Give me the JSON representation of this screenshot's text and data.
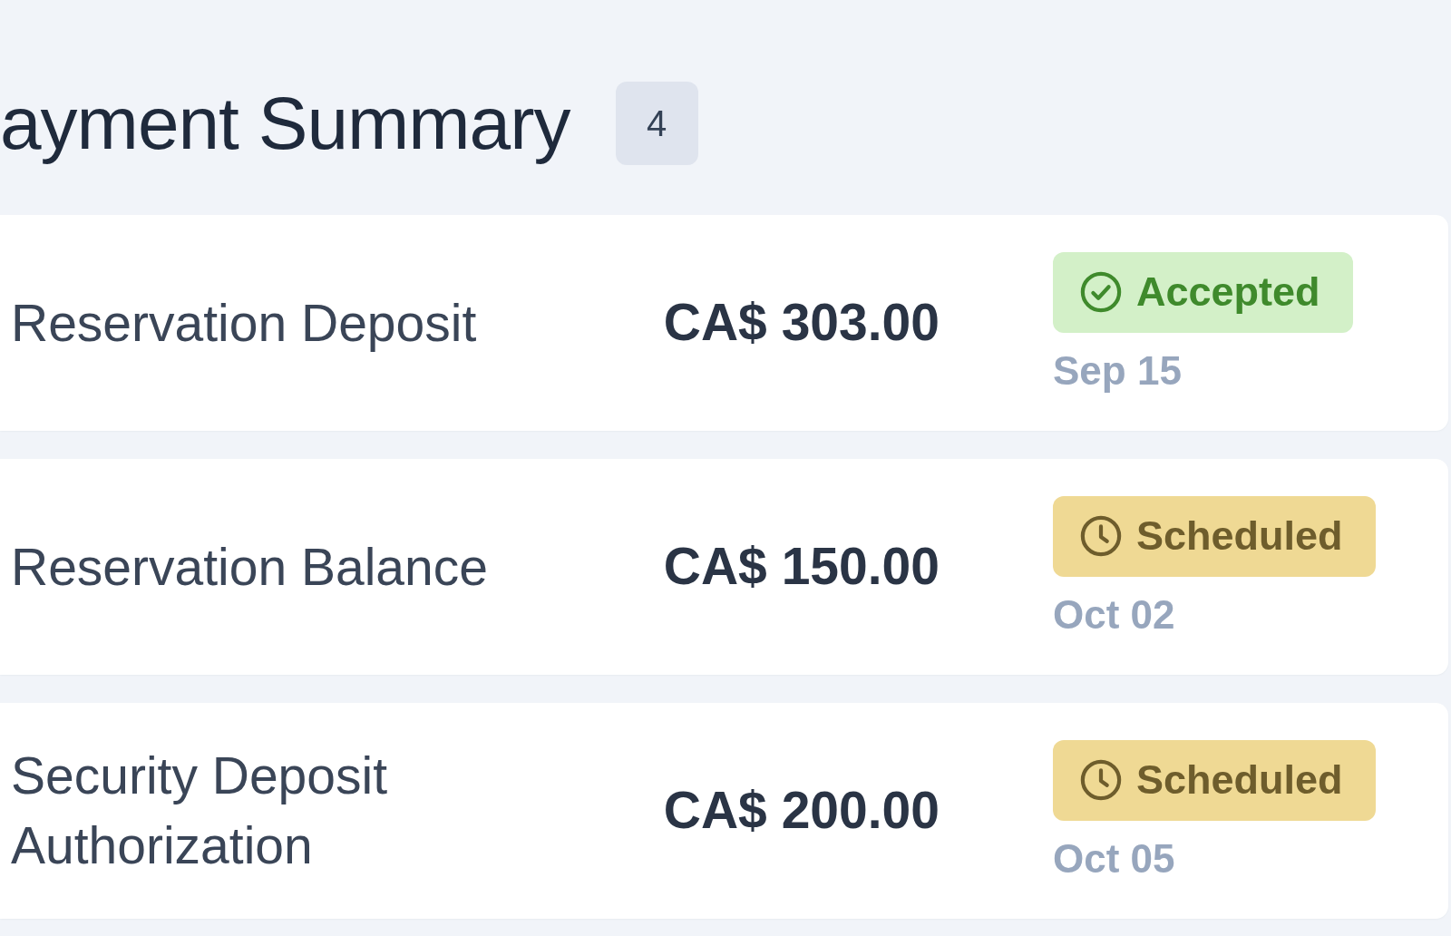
{
  "header": {
    "title": "ayment Summary",
    "count": "4"
  },
  "payments": [
    {
      "label": "Reservation Deposit",
      "amount": "CA$ 303.00",
      "status": {
        "kind": "accepted",
        "label": "Accepted"
      },
      "date": "Sep 15"
    },
    {
      "label": "Reservation Balance",
      "amount": "CA$ 150.00",
      "status": {
        "kind": "scheduled",
        "label": "Scheduled"
      },
      "date": "Oct 02"
    },
    {
      "label": "Security Deposit Authorization",
      "amount": "CA$ 200.00",
      "status": {
        "kind": "scheduled",
        "label": "Scheduled"
      },
      "date": "Oct 05"
    }
  ]
}
